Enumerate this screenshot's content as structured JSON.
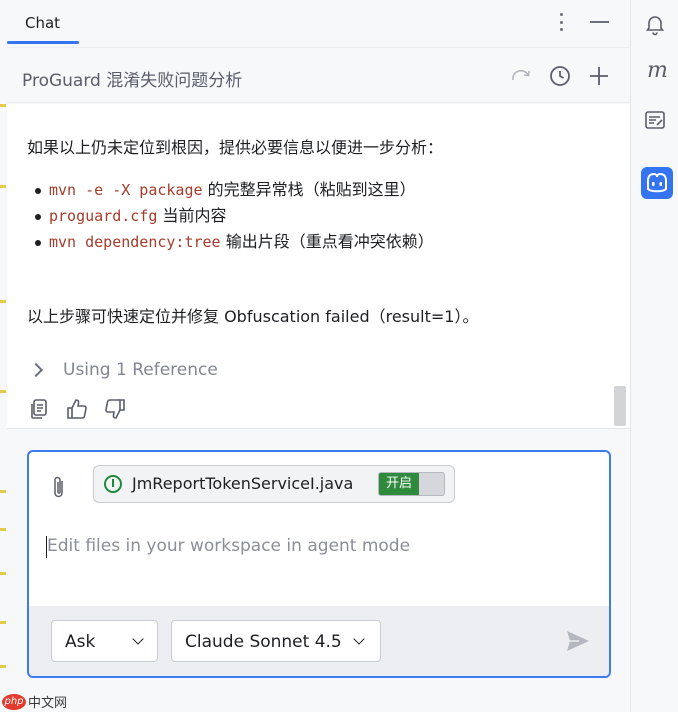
{
  "tab": {
    "label": "Chat"
  },
  "conversation": {
    "title": "ProGuard 混淆失败问题分析"
  },
  "message": {
    "intro": "如果以上仍未定位到根因，提供必要信息以便进一步分析：",
    "bullets": [
      {
        "code": "mvn -e -X package",
        "text": "的完整异常栈（粘贴到这里）"
      },
      {
        "code": "proguard.cfg",
        "text": "当前内容"
      },
      {
        "code": "mvn dependency:tree",
        "text": "输出片段（重点看冲突依赖）"
      }
    ],
    "outro": "以上步骤可快速定位并修复 Obfuscation failed（result=1）。",
    "reference": "Using 1 Reference"
  },
  "input": {
    "file_chip": {
      "name": "JmReportTokenServiceI.java",
      "toggle_label": "开启"
    },
    "placeholder": "Edit files in your workspace in agent mode",
    "mode": "Ask",
    "model": "Claude Sonnet 4.5"
  },
  "watermark": {
    "logo": "php",
    "text": "中文网"
  },
  "colors": {
    "accent": "#3574f0",
    "code": "#a63c2b",
    "toggle_on": "#2f8a3e"
  },
  "icons": [
    "kebab-menu-icon",
    "minimize-icon",
    "redo-icon",
    "history-icon",
    "plus-icon",
    "copy-icon",
    "thumbs-up-icon",
    "thumbs-down-icon",
    "paperclip-icon",
    "send-icon",
    "bell-icon",
    "m-icon",
    "notes-icon",
    "copilot-icon"
  ]
}
